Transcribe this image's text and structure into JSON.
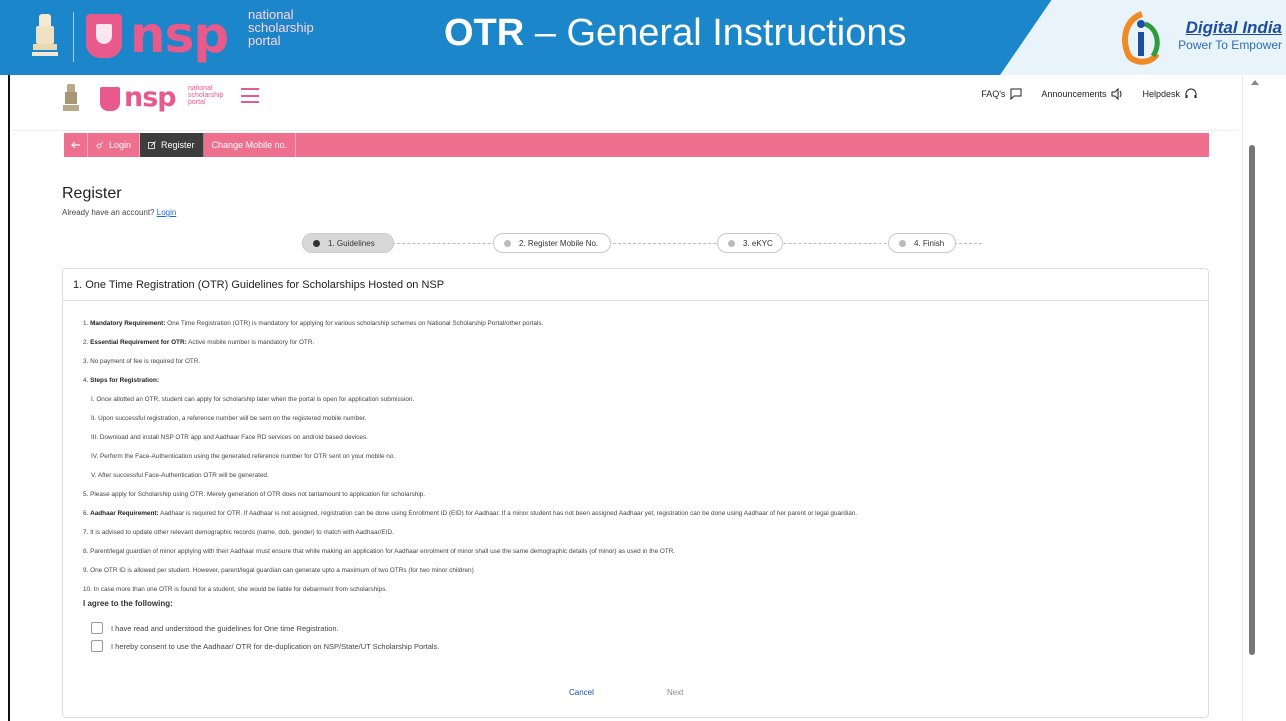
{
  "banner": {
    "logo_text": "nsp",
    "logo_line1": "national",
    "logo_line2": "scholarship",
    "logo_line3": "portal",
    "title_bold": "OTR",
    "title_rest": " – General Instructions",
    "di_main": "Digital India",
    "di_sub": "Power To Empower",
    "di_color": "#1d4fa0"
  },
  "topbar": {
    "logo_text": "nsp",
    "logo_line1": "national",
    "logo_line2": "scholarship",
    "logo_line3": "portal",
    "nav": {
      "faqs": "FAQ's",
      "announcements": "Announcements",
      "helpdesk": "Helpdesk"
    }
  },
  "pinkbar": {
    "color": "#ee6f8e",
    "login": "Login",
    "register": "Register",
    "change_mobile": "Change Mobile no."
  },
  "register": {
    "title": "Register",
    "already": "Already have an account?",
    "login_link": "Login"
  },
  "steps": [
    {
      "label": "1. Guidelines"
    },
    {
      "label": "2. Register Mobile No."
    },
    {
      "label": "3. eKYC"
    },
    {
      "label": "4. Finish"
    }
  ],
  "card": {
    "heading": "1. One Time Registration (OTR) Guidelines for Scholarships Hosted on NSP",
    "g1_num": "1. ",
    "g1_bold": "Mandatory Requirement:",
    "g1_text": " One Time Registration (OTR) is mandatory for applying for various scholarship schemes on National Scholarship Portal/other portals.",
    "g2_num": "2. ",
    "g2_bold": "Essential Requirement for OTR:",
    "g2_text": " Active mobile number is mandatory for OTR.",
    "g3": "3. No payment of fee is required for OTR.",
    "g4_num": "4. ",
    "g4_bold": "Steps for Registration:",
    "s1": "I. Once allotted an OTR, student can apply for scholarship later when the portal is open for application submission.",
    "s2": "II. Upon successful registration, a reference number will be sent on the registered mobile number.",
    "s3": "III. Download and install NSP OTR app and Aadhaar Face RD services on android based devices.",
    "s4": "IV. Perform the Face-Authentication using the generated reference number for OTR sent on your mobile no.",
    "s5": "V. After successful Face-Authentication OTR will be generated.",
    "g5": "5. Please apply for Scholarship using OTR. Merely generation of OTR does not tantamount to application for scholarship.",
    "g6_num": "6. ",
    "g6_bold": "Aadhaar Requirement:",
    "g6_text": " Aadhaar is required for OTR. If Aadhaar is not assigned, registration can be done using Enrollment ID (EID) for Aadhaar. If a minor student has not been assigned Aadhaar yet, registration can be done using Aadhaar of her parent or legal guardian.",
    "g7": "7. It is advised to update other relevant demographic records (name, dob, gender) to match with Aadhaar/EID.",
    "g8": "8. Parent/legal guardian of minor applying with their Aadhaar must ensure that while making an application for Aadhaar enrolment of minor shall use the same demographic details (of minor) as used in the OTR.",
    "g9": "9. One OTR ID is allowed per student. However, parent/legal guardian can generate upto a maximum of two OTRs (for two minor children)",
    "g10": "10. In case more than one OTR is found for a student, she would be liable for debarment from scholarships.",
    "agree_heading": "I agree to the following:",
    "check1": "I have read and understood the guidelines for One time Registration.",
    "check2": "I hereby consent to use the Aadhaar/ OTR for de-duplication on NSP/State/UT Scholarship Portals.",
    "cancel": "Cancel",
    "next": "Next"
  }
}
